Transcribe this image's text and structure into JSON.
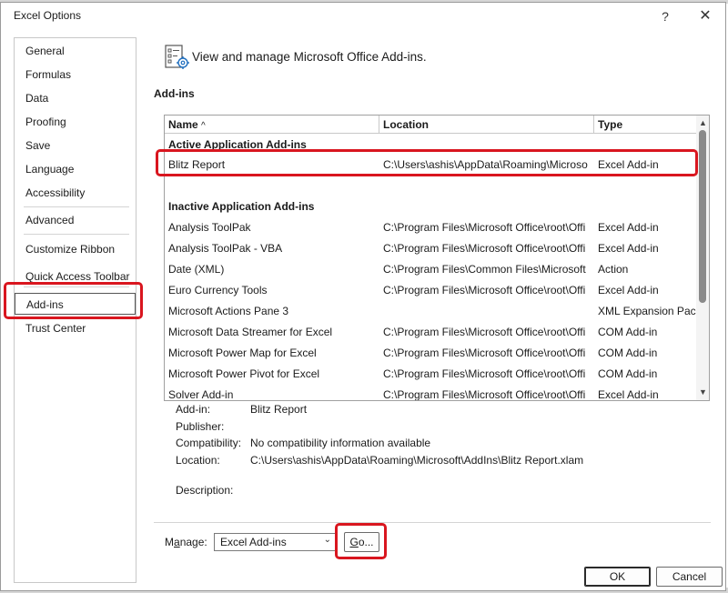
{
  "window": {
    "title": "Excel Options",
    "help_glyph": "?",
    "close_glyph": "✕"
  },
  "nav": {
    "items": [
      {
        "label": "General"
      },
      {
        "label": "Formulas"
      },
      {
        "label": "Data"
      },
      {
        "label": "Proofing"
      },
      {
        "label": "Save"
      },
      {
        "label": "Language"
      },
      {
        "label": "Accessibility"
      },
      {
        "label": "Advanced"
      },
      {
        "label": "Customize Ribbon"
      },
      {
        "label": "Quick Access Toolbar"
      },
      {
        "label": "Add-ins"
      },
      {
        "label": "Trust Center"
      }
    ],
    "selected": "Add-ins"
  },
  "header": {
    "text": "View and manage Microsoft Office Add-ins.",
    "icon": "addins-gear-icon"
  },
  "addins": {
    "section_title": "Add-ins",
    "columns": {
      "name": "Name",
      "location": "Location",
      "type": "Type"
    },
    "sort_glyph": "^",
    "active_group": "Active Application Add-ins",
    "active_rows": [
      {
        "name": "Blitz Report",
        "location": "C:\\Users\\ashis\\AppData\\Roaming\\Microso",
        "type": "Excel Add-in"
      }
    ],
    "inactive_group": "Inactive Application Add-ins",
    "inactive_rows": [
      {
        "name": "Analysis ToolPak",
        "location": "C:\\Program Files\\Microsoft Office\\root\\Offi",
        "type": "Excel Add-in"
      },
      {
        "name": "Analysis ToolPak - VBA",
        "location": "C:\\Program Files\\Microsoft Office\\root\\Offi",
        "type": "Excel Add-in"
      },
      {
        "name": "Date (XML)",
        "location": "C:\\Program Files\\Common Files\\Microsoft",
        "type": "Action"
      },
      {
        "name": "Euro Currency Tools",
        "location": "C:\\Program Files\\Microsoft Office\\root\\Offi",
        "type": "Excel Add-in"
      },
      {
        "name": "Microsoft Actions Pane 3",
        "location": "",
        "type": "XML Expansion Pack"
      },
      {
        "name": "Microsoft Data Streamer for Excel",
        "location": "C:\\Program Files\\Microsoft Office\\root\\Offi",
        "type": "COM Add-in"
      },
      {
        "name": "Microsoft Power Map for Excel",
        "location": "C:\\Program Files\\Microsoft Office\\root\\Offi",
        "type": "COM Add-in"
      },
      {
        "name": "Microsoft Power Pivot for Excel",
        "location": "C:\\Program Files\\Microsoft Office\\root\\Offi",
        "type": "COM Add-in"
      },
      {
        "name": "Solver Add-in",
        "location": "C:\\Program Files\\Microsoft Office\\root\\Offi",
        "type": "Excel Add-in"
      }
    ]
  },
  "details": {
    "addin_label": "Add-in:",
    "addin_value": "Blitz Report",
    "publisher_label": "Publisher:",
    "publisher_value": "",
    "compat_label": "Compatibility:",
    "compat_value": "No compatibility information available",
    "location_label": "Location:",
    "location_value": "C:\\Users\\ashis\\AppData\\Roaming\\Microsoft\\AddIns\\Blitz Report.xlam",
    "description_label": "Description:",
    "description_value": ""
  },
  "manage": {
    "label_pre": "M",
    "label_u": "a",
    "label_post": "nage:",
    "selected": "Excel Add-ins",
    "go_u": "G",
    "go_post": "o..."
  },
  "buttons": {
    "ok": "OK",
    "cancel": "Cancel"
  },
  "colors": {
    "highlight": "#d9161f"
  }
}
